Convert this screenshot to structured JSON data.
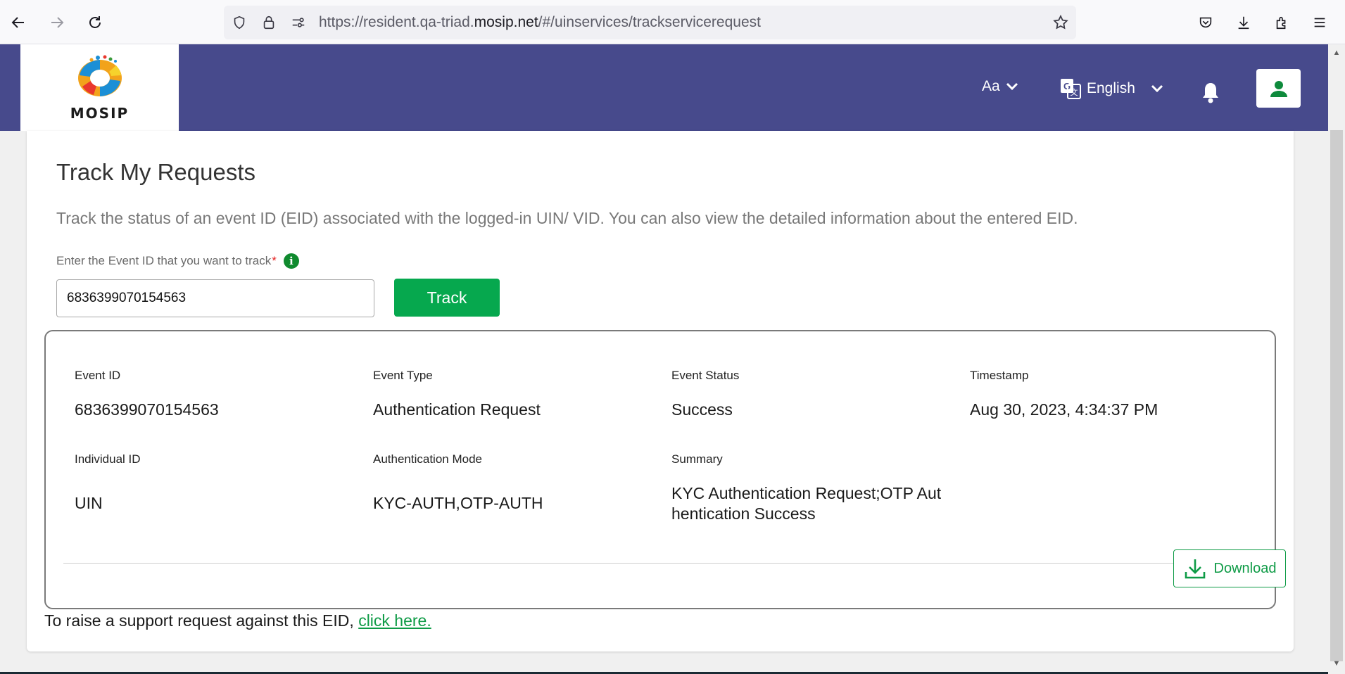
{
  "browser": {
    "url_prefix": "https://resident.qa-triad.",
    "url_domain": "mosip.net",
    "url_suffix": "/#/uinservices/trackservicerequest"
  },
  "header": {
    "logo_text": "MOSIP",
    "font_size_label": "Aa",
    "language": "English",
    "accent_color": "#474a8c"
  },
  "page": {
    "title": "Track My Requests",
    "description": "Track the status of an event ID (EID) associated with the logged-in UIN/ VID. You can also view the detailed information about the entered EID.",
    "field_label": "Enter the Event ID that you want to track",
    "required_mark": "*",
    "input_value": "6836399070154563",
    "track_label": "Track"
  },
  "result": {
    "event_id_label": "Event ID",
    "event_id": "6836399070154563",
    "event_type_label": "Event Type",
    "event_type": "Authentication Request",
    "event_status_label": "Event Status",
    "event_status": "Success",
    "timestamp_label": "Timestamp",
    "timestamp": "Aug 30, 2023, 4:34:37 PM",
    "individual_id_label": "Individual ID",
    "individual_id": "UIN",
    "auth_mode_label": "Authentication Mode",
    "auth_mode": "KYC-AUTH,OTP-AUTH",
    "summary_label": "Summary",
    "summary_line1": "KYC Authentication Request;OTP Aut",
    "summary_line2": "hentication Success",
    "download_label": "Download"
  },
  "support": {
    "text": "To raise a support request against this EID, ",
    "link_text": "click here."
  }
}
